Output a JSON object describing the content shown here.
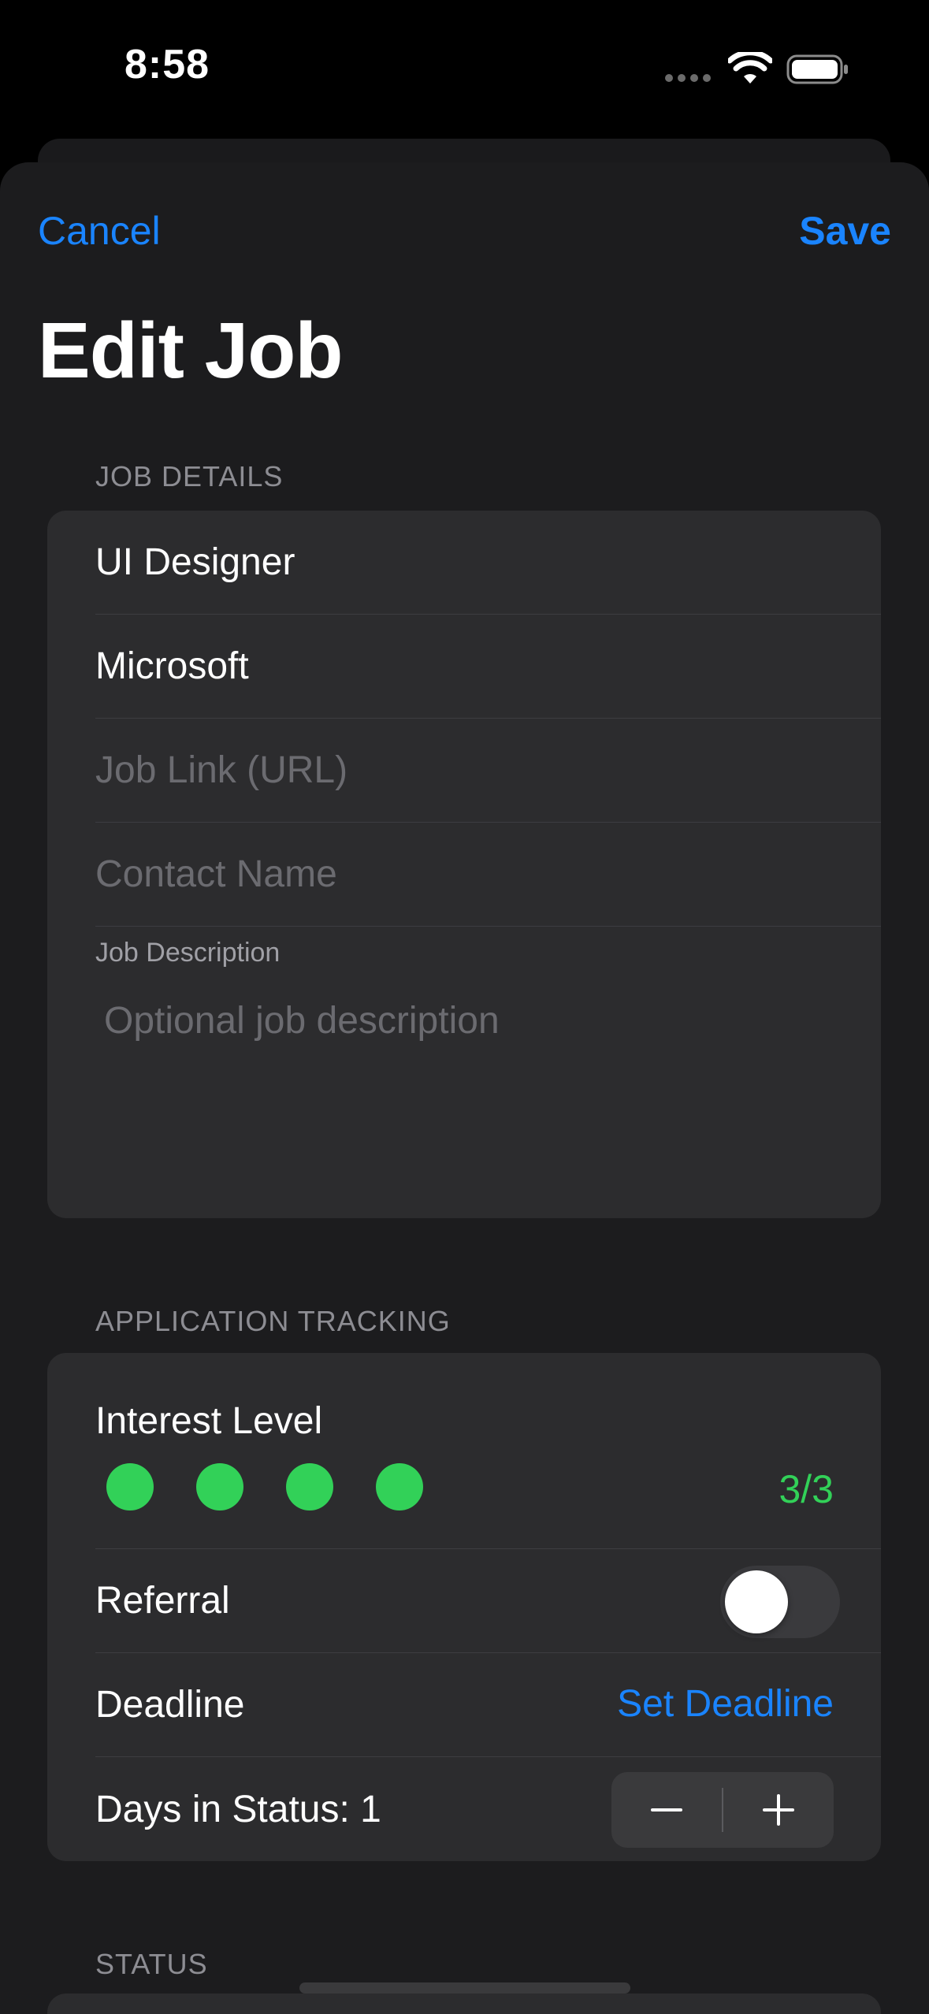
{
  "status_bar": {
    "time": "8:58",
    "wifi_icon": "wifi-icon",
    "battery_icon": "battery-icon"
  },
  "nav": {
    "cancel_label": "Cancel",
    "save_label": "Save",
    "title": "Edit Job"
  },
  "job_details": {
    "header": "JOB DETAILS",
    "job_title_value": "UI Designer",
    "company_value": "Microsoft",
    "job_link_placeholder": "Job Link (URL)",
    "contact_name_placeholder": "Contact Name",
    "description_label": "Job Description",
    "description_placeholder": "Optional job description"
  },
  "application_tracking": {
    "header": "APPLICATION TRACKING",
    "interest_label": "Interest Level",
    "interest_dots": 4,
    "interest_text": "3/3",
    "referral_label": "Referral",
    "referral_on": false,
    "deadline_label": "Deadline",
    "deadline_action": "Set Deadline",
    "days_in_status_label": "Days in Status: 1",
    "minus_icon": "minus-icon",
    "plus_icon": "plus-icon"
  },
  "status_section": {
    "header": "STATUS"
  },
  "colors": {
    "accent": "#1a84ff",
    "interest_green": "#32d158",
    "sheet_bg": "#1c1c1e",
    "card_bg": "#2c2c2e"
  }
}
